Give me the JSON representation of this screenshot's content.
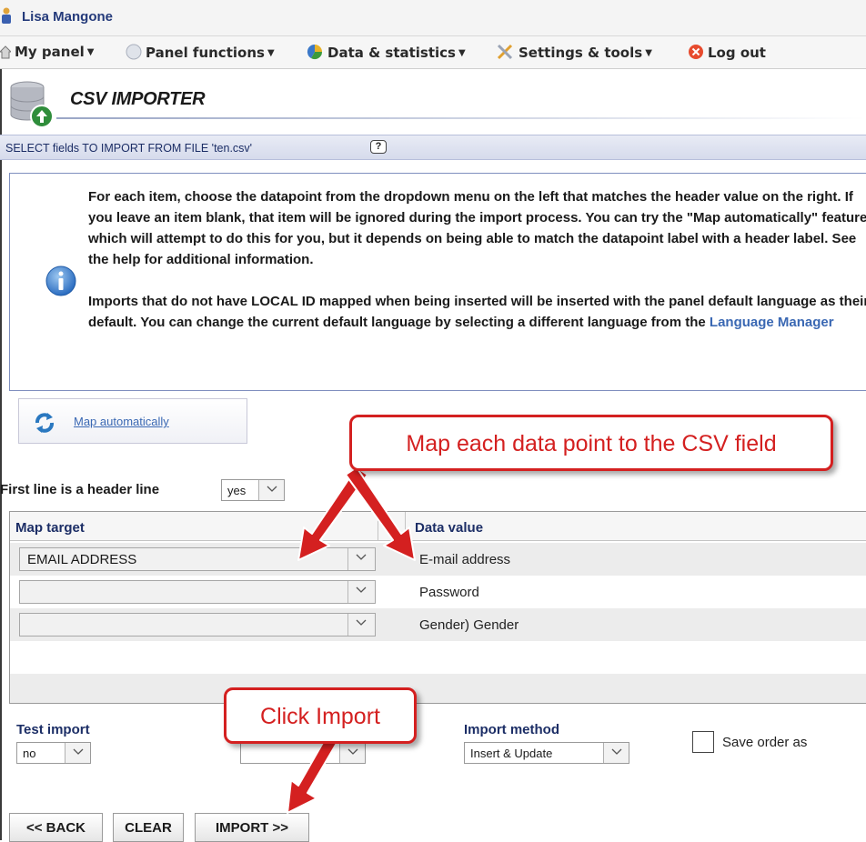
{
  "user": {
    "name": "Lisa Mangone"
  },
  "menu": [
    {
      "label": "My panel",
      "icon": "home-icon"
    },
    {
      "label": "Panel functions",
      "icon": "panel-icon"
    },
    {
      "label": "Data & statistics",
      "icon": "chart-icon"
    },
    {
      "label": "Settings & tools",
      "icon": "tools-icon"
    },
    {
      "label": "Log out",
      "icon": "logout-icon"
    }
  ],
  "importer": {
    "title": "CSV IMPORTER",
    "select_bar": "SELECT fields TO IMPORT FROM FILE 'ten.csv'",
    "help_glyph": "?"
  },
  "info": {
    "paragraph1": "For each item, choose the datapoint from the dropdown menu on the left that matches the header value on the right. If you leave an item blank, that item will be ignored during the import process. You can try the \"Map automatically\" feature, which will attempt to do this for you, but it depends on being able to match the datapoint label with a header label. See the help for additional information.",
    "paragraph2_prefix": "Imports that do not have LOCAL ID mapped when being inserted will be inserted with the panel default language as their default. You can change the current default language by selecting a different language from the ",
    "paragraph2_link": "Language Manager"
  },
  "map_auto": {
    "label": "Map automatically"
  },
  "header_line": {
    "label": "First line is a header line",
    "value": "yes"
  },
  "table": {
    "col_target": "Map target",
    "col_value": "Data value",
    "rows": [
      {
        "target": "EMAIL ADDRESS",
        "value": "E-mail address"
      },
      {
        "target": "",
        "value": "Password"
      },
      {
        "target": "",
        "value": "Gender) Gender"
      }
    ]
  },
  "test_import": {
    "label": "Test import",
    "value": "no"
  },
  "import_method": {
    "label": "Import method",
    "value": "Insert & Update"
  },
  "save_order": {
    "label": "Save order as"
  },
  "buttons": {
    "back": "<< BACK",
    "clear": "CLEAR",
    "import": "IMPORT >>"
  },
  "callouts": {
    "map": "Map each data point to the CSV field",
    "import": "Click Import"
  },
  "colors": {
    "callout_red": "#d42020",
    "link_blue": "#3a68b3",
    "header_navy": "#1c2e66"
  }
}
